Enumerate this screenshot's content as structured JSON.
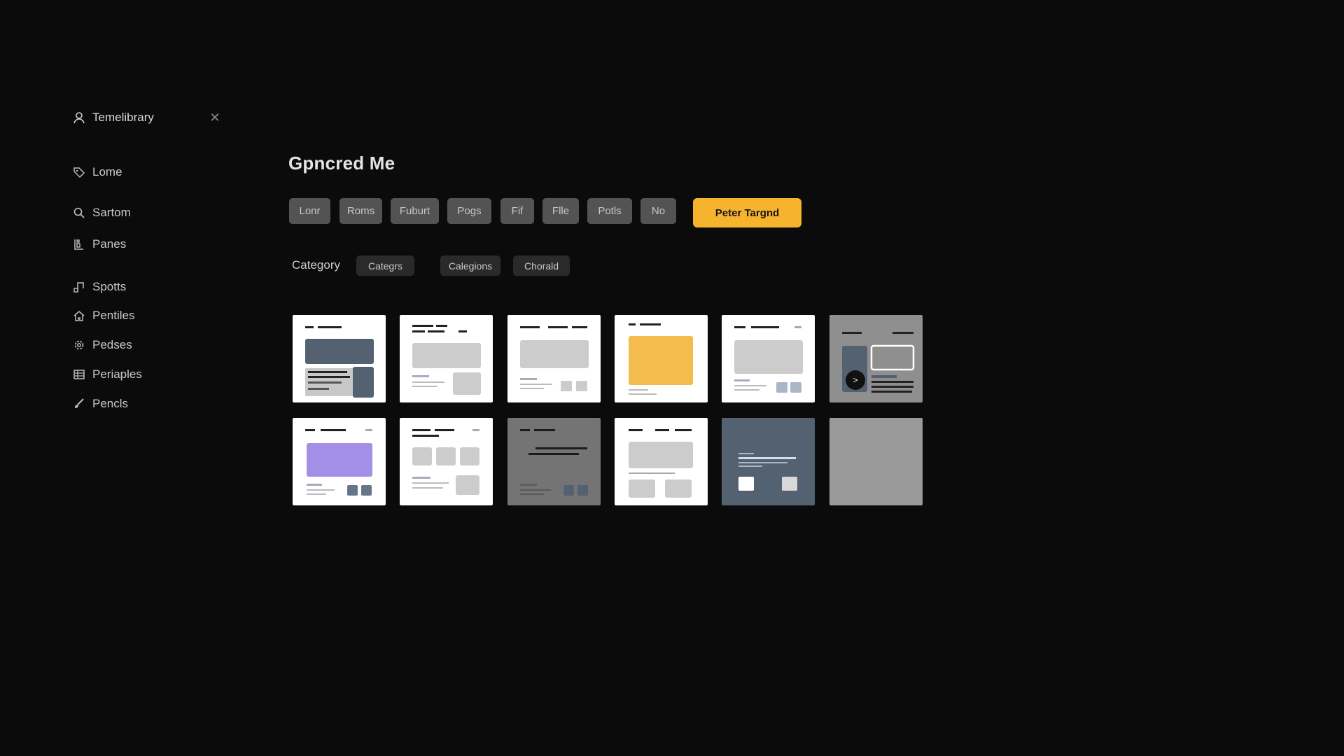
{
  "sidebar": {
    "title": "Temelibrary",
    "title_icon": "user-icon",
    "close_icon": "close-icon",
    "items": [
      {
        "label": "Lome",
        "icon": "tag-icon"
      },
      {
        "label": "Sartom",
        "icon": "search-icon"
      },
      {
        "label": "Panes",
        "icon": "layout-icon"
      },
      {
        "label": "Spotts",
        "icon": "music-icon"
      },
      {
        "label": "Pentiles",
        "icon": "home-icon"
      },
      {
        "label": "Pedses",
        "icon": "gear-icon"
      },
      {
        "label": "Periaples",
        "icon": "table-icon"
      },
      {
        "label": "Pencls",
        "icon": "brush-icon"
      }
    ]
  },
  "main": {
    "title": "Gpncred Me",
    "filters": [
      "Lonr",
      "Roms",
      "Fuburt",
      "Pogs",
      "Fif",
      "Flle",
      "Potls",
      "No"
    ],
    "primary_button": "Peter Targnd",
    "category": {
      "label": "Category",
      "chips": [
        "Categrs",
        "Calegions",
        "Chorald"
      ]
    }
  },
  "colors": {
    "background": "#0b0b0b",
    "accent": "#f6b42e",
    "chip": "#535353",
    "card_slate": "#536170",
    "card_purple": "#a48fe6"
  },
  "templates": [
    {
      "variant": "slate-feature",
      "background": "white",
      "accent": "#536170"
    },
    {
      "variant": "gray-feature",
      "background": "white",
      "accent": "#cccccc"
    },
    {
      "variant": "gray-feature",
      "background": "white",
      "accent": "#cccccc"
    },
    {
      "variant": "yellow-feature",
      "background": "white",
      "accent": "#f6b42e"
    },
    {
      "variant": "gray-feature",
      "background": "white",
      "accent": "#cccccc"
    },
    {
      "variant": "dark-media",
      "background": "gray",
      "accent": "#536170",
      "play_icon": "play-icon"
    },
    {
      "variant": "purple-feature",
      "background": "white",
      "accent": "#a48fe6"
    },
    {
      "variant": "gray-tiles",
      "background": "white",
      "accent": "#cccccc"
    },
    {
      "variant": "dark-text",
      "background": "gray",
      "accent": "#536170"
    },
    {
      "variant": "gray-blocks",
      "background": "white",
      "accent": "#cccccc"
    },
    {
      "variant": "slate-cards",
      "background": "slate",
      "accent": "#ffffff"
    },
    {
      "variant": "blank",
      "background": "gray",
      "accent": "#9a9a9a"
    }
  ]
}
